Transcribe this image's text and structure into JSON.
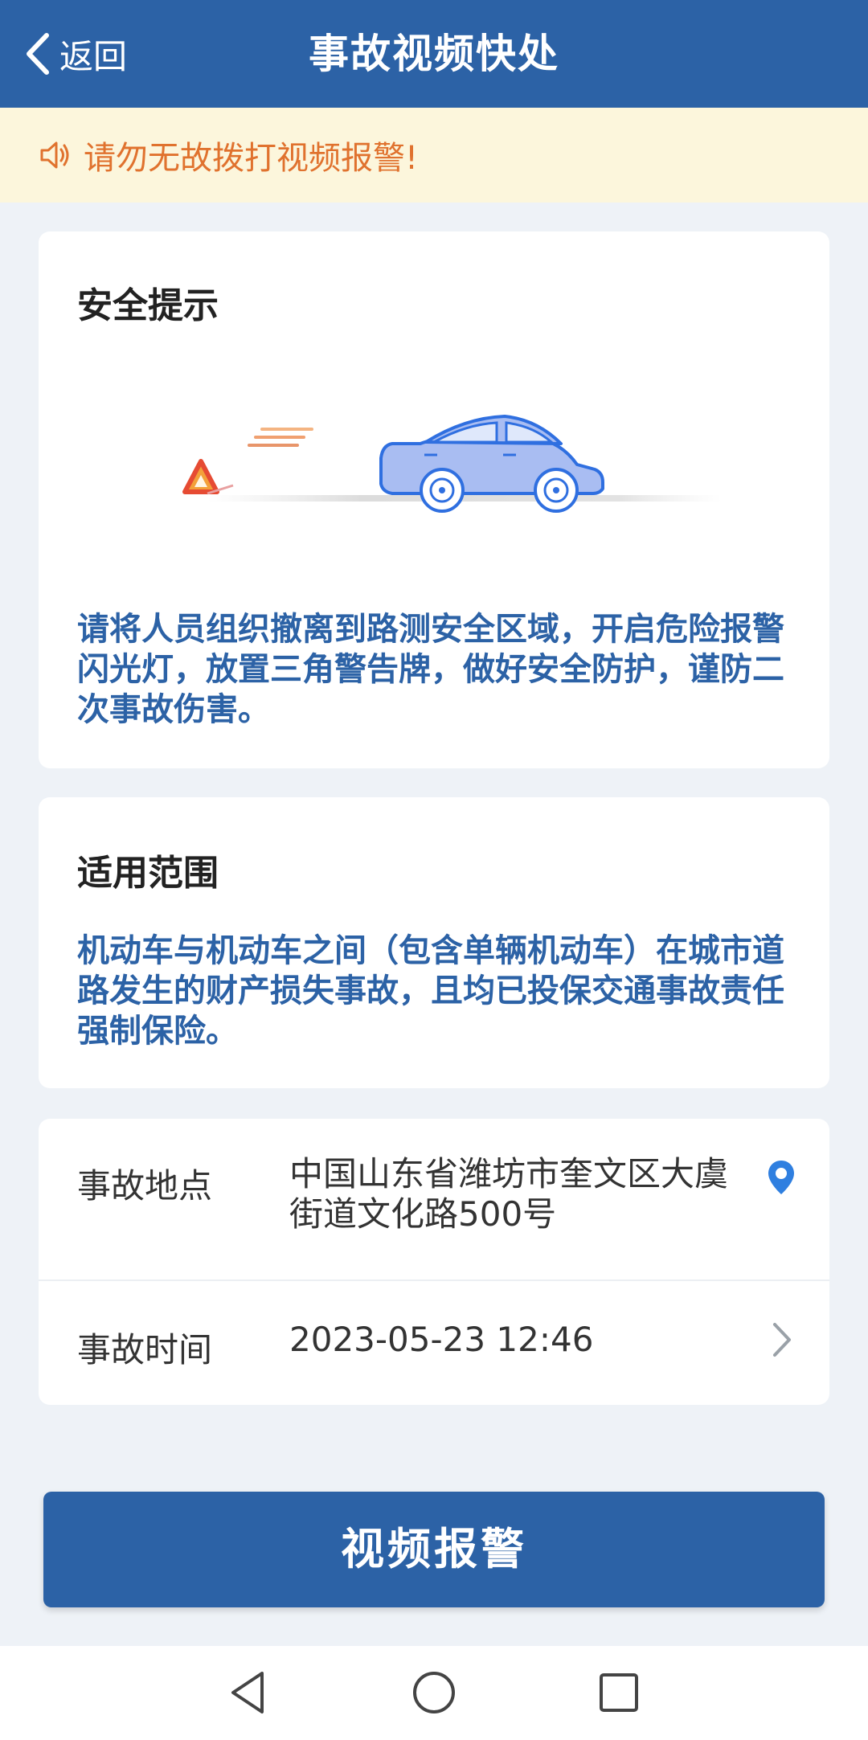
{
  "header": {
    "back_label": "返回",
    "title": "事故视频快处"
  },
  "notice": {
    "text": "请勿无故拨打视频报警!"
  },
  "safety": {
    "title": "安全提示",
    "text": "请将人员组织撤离到路测安全区域，开启危险报警闪光灯，放置三角警告牌，做好安全防护，谨防二次事故伤害。"
  },
  "scope": {
    "title": "适用范围",
    "text": "机动车与机动车之间（包含单辆机动车）在城市道路发生的财产损失事故，且均已投保交通事故责任强制保险。"
  },
  "form": {
    "location_label": "事故地点",
    "location_value": "中国山东省潍坊市奎文区大虞街道文化路500号",
    "time_label": "事故时间",
    "time_value": "2023-05-23 12:46"
  },
  "action": {
    "report_label": "视频报警"
  },
  "colors": {
    "brand": "#2c62a6",
    "notice_bg": "#fcf6dc",
    "notice_text": "#e0722e"
  },
  "icons": [
    "chevron-left-icon",
    "speaker-icon",
    "location-pin-icon",
    "chevron-right-icon",
    "nav-back-icon",
    "nav-home-icon",
    "nav-recents-icon"
  ]
}
